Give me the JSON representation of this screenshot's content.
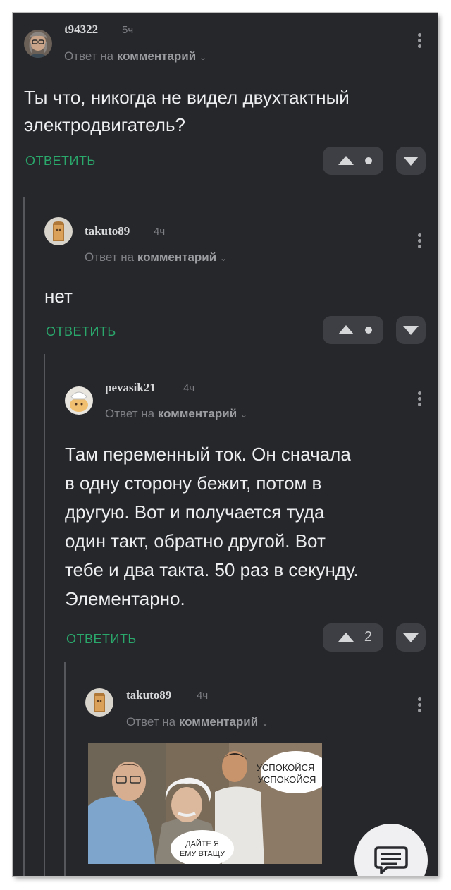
{
  "comments": [
    {
      "username": "t94322",
      "time": "5ч",
      "reply_prefix": "Ответ на",
      "reply_target": "комментарий",
      "text_lines": [
        "Ты что, никогда не видел двухтактный",
        "электродвигатель?"
      ],
      "reply_label": "ОТВЕТИТЬ",
      "rating": ""
    },
    {
      "username": "takuto89",
      "time": "4ч",
      "reply_prefix": "Ответ на",
      "reply_target": "комментарий",
      "text_lines": [
        "нет"
      ],
      "reply_label": "ОТВЕТИТЬ",
      "rating": ""
    },
    {
      "username": "pevasik21",
      "time": "4ч",
      "reply_prefix": "Ответ на",
      "reply_target": "комментарий",
      "text_lines": [
        "Там переменный ток. Он сначала",
        "в одну сторону бежит, потом в",
        "другую. Вот и получается туда",
        "один такт, обратно другой. Вот",
        "тебе и два такта. 50 раз в секунду.",
        "Элементарно."
      ],
      "reply_label": "ОТВЕТИТЬ",
      "rating": "2"
    },
    {
      "username": "takuto89",
      "time": "4ч",
      "reply_prefix": "Ответ на",
      "reply_target": "комментарий",
      "meme": {
        "caption_top": [
          "УСПОКОЙСЯ",
          "УСПОКОЙСЯ"
        ],
        "caption_bottom": [
          "ДАЙТЕ Я",
          "ЕМУ ВТАЩУ"
        ]
      }
    }
  ],
  "icons": {
    "upvote": "triangle-up-icon",
    "downvote": "triangle-down-icon",
    "menu": "more-vertical-icon",
    "reply_chevron": "chevron-down-icon",
    "fab": "comment-icon"
  },
  "colors": {
    "background": "#26272b",
    "reply_green": "#2aa86c",
    "button_bg": "#3d3f44"
  }
}
